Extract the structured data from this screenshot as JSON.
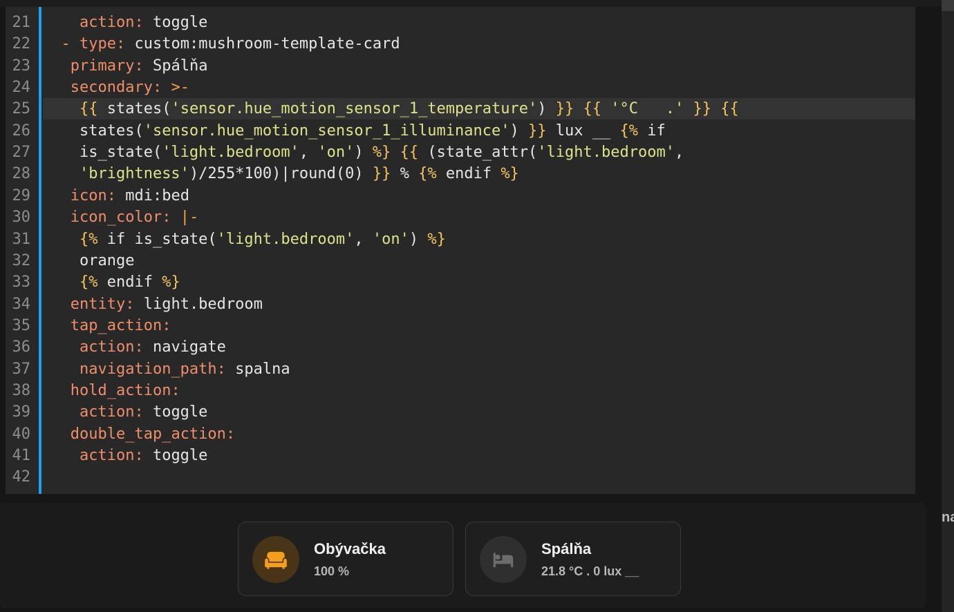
{
  "editor": {
    "lines": [
      {
        "num": "21",
        "active": false,
        "tokens": [
          {
            "t": "    ",
            "c": "plain"
          },
          {
            "t": "action:",
            "c": "key"
          },
          {
            "t": " toggle",
            "c": "plain"
          }
        ]
      },
      {
        "num": "22",
        "active": false,
        "tokens": [
          {
            "t": "  ",
            "c": "plain"
          },
          {
            "t": "-",
            "c": "dash"
          },
          {
            "t": " ",
            "c": "plain"
          },
          {
            "t": "type:",
            "c": "key"
          },
          {
            "t": " custom:mushroom-template-card",
            "c": "plain"
          }
        ]
      },
      {
        "num": "23",
        "active": false,
        "tokens": [
          {
            "t": "   ",
            "c": "plain"
          },
          {
            "t": "primary:",
            "c": "key"
          },
          {
            "t": " Spálňa",
            "c": "plain"
          }
        ]
      },
      {
        "num": "24",
        "active": false,
        "tokens": [
          {
            "t": "   ",
            "c": "plain"
          },
          {
            "t": "secondary:",
            "c": "key"
          },
          {
            "t": " >-",
            "c": "dash"
          }
        ]
      },
      {
        "num": "25",
        "active": true,
        "tokens": [
          {
            "t": "    ",
            "c": "plain"
          },
          {
            "t": "{{",
            "c": "brace"
          },
          {
            "t": " states(",
            "c": "plain"
          },
          {
            "t": "'sensor.hue_motion_sensor_1_temperature'",
            "c": "str"
          },
          {
            "t": ") ",
            "c": "plain"
          },
          {
            "t": "}}",
            "c": "brace"
          },
          {
            "t": " ",
            "c": "plain"
          },
          {
            "t": "{{",
            "c": "brace"
          },
          {
            "t": " ",
            "c": "plain"
          },
          {
            "t": "'°C   .'",
            "c": "str"
          },
          {
            "t": " ",
            "c": "plain"
          },
          {
            "t": "}}",
            "c": "brace"
          },
          {
            "t": " ",
            "c": "plain"
          },
          {
            "t": "{{",
            "c": "brace"
          }
        ]
      },
      {
        "num": "26",
        "active": false,
        "tokens": [
          {
            "t": "    states(",
            "c": "plain"
          },
          {
            "t": "'sensor.hue_motion_sensor_1_illuminance'",
            "c": "str"
          },
          {
            "t": ") ",
            "c": "plain"
          },
          {
            "t": "}}",
            "c": "brace"
          },
          {
            "t": " lux __ ",
            "c": "plain"
          },
          {
            "t": "{%",
            "c": "brace"
          },
          {
            "t": " if",
            "c": "plain"
          }
        ]
      },
      {
        "num": "27",
        "active": false,
        "tokens": [
          {
            "t": "    is_state(",
            "c": "plain"
          },
          {
            "t": "'light.bedroom'",
            "c": "str"
          },
          {
            "t": ", ",
            "c": "plain"
          },
          {
            "t": "'on'",
            "c": "str"
          },
          {
            "t": ") ",
            "c": "plain"
          },
          {
            "t": "%}",
            "c": "brace"
          },
          {
            "t": " ",
            "c": "plain"
          },
          {
            "t": "{{",
            "c": "brace"
          },
          {
            "t": " (state_attr(",
            "c": "plain"
          },
          {
            "t": "'light.bedroom'",
            "c": "str"
          },
          {
            "t": ",",
            "c": "plain"
          }
        ]
      },
      {
        "num": "28",
        "active": false,
        "tokens": [
          {
            "t": "    ",
            "c": "plain"
          },
          {
            "t": "'brightness'",
            "c": "str"
          },
          {
            "t": ")/255*100)|round(0) ",
            "c": "plain"
          },
          {
            "t": "}}",
            "c": "brace"
          },
          {
            "t": " % ",
            "c": "plain"
          },
          {
            "t": "{%",
            "c": "brace"
          },
          {
            "t": " endif ",
            "c": "plain"
          },
          {
            "t": "%}",
            "c": "brace"
          }
        ]
      },
      {
        "num": "29",
        "active": false,
        "tokens": [
          {
            "t": "   ",
            "c": "plain"
          },
          {
            "t": "icon:",
            "c": "key"
          },
          {
            "t": " mdi:bed",
            "c": "plain"
          }
        ]
      },
      {
        "num": "30",
        "active": false,
        "tokens": [
          {
            "t": "   ",
            "c": "plain"
          },
          {
            "t": "icon_color:",
            "c": "key"
          },
          {
            "t": " |-",
            "c": "dash"
          }
        ]
      },
      {
        "num": "31",
        "active": false,
        "tokens": [
          {
            "t": "    ",
            "c": "plain"
          },
          {
            "t": "{%",
            "c": "brace"
          },
          {
            "t": " if is_state(",
            "c": "plain"
          },
          {
            "t": "'light.bedroom'",
            "c": "str"
          },
          {
            "t": ", ",
            "c": "plain"
          },
          {
            "t": "'on'",
            "c": "str"
          },
          {
            "t": ") ",
            "c": "plain"
          },
          {
            "t": "%}",
            "c": "brace"
          }
        ]
      },
      {
        "num": "32",
        "active": false,
        "tokens": [
          {
            "t": "    orange",
            "c": "plain"
          }
        ]
      },
      {
        "num": "33",
        "active": false,
        "tokens": [
          {
            "t": "    ",
            "c": "plain"
          },
          {
            "t": "{%",
            "c": "brace"
          },
          {
            "t": " endif ",
            "c": "plain"
          },
          {
            "t": "%}",
            "c": "brace"
          }
        ]
      },
      {
        "num": "34",
        "active": false,
        "tokens": [
          {
            "t": "   ",
            "c": "plain"
          },
          {
            "t": "entity:",
            "c": "key"
          },
          {
            "t": " light.bedroom",
            "c": "plain"
          }
        ]
      },
      {
        "num": "35",
        "active": false,
        "tokens": [
          {
            "t": "   ",
            "c": "plain"
          },
          {
            "t": "tap_action:",
            "c": "key"
          }
        ]
      },
      {
        "num": "36",
        "active": false,
        "tokens": [
          {
            "t": "    ",
            "c": "plain"
          },
          {
            "t": "action:",
            "c": "key"
          },
          {
            "t": " navigate",
            "c": "plain"
          }
        ]
      },
      {
        "num": "37",
        "active": false,
        "tokens": [
          {
            "t": "    ",
            "c": "plain"
          },
          {
            "t": "navigation_path:",
            "c": "key"
          },
          {
            "t": " spalna",
            "c": "plain"
          }
        ]
      },
      {
        "num": "38",
        "active": false,
        "tokens": [
          {
            "t": "   ",
            "c": "plain"
          },
          {
            "t": "hold_action:",
            "c": "key"
          }
        ]
      },
      {
        "num": "39",
        "active": false,
        "tokens": [
          {
            "t": "    ",
            "c": "plain"
          },
          {
            "t": "action:",
            "c": "key"
          },
          {
            "t": " toggle",
            "c": "plain"
          }
        ]
      },
      {
        "num": "40",
        "active": false,
        "tokens": [
          {
            "t": "   ",
            "c": "plain"
          },
          {
            "t": "double_tap_action:",
            "c": "key"
          }
        ]
      },
      {
        "num": "41",
        "active": false,
        "tokens": [
          {
            "t": "    ",
            "c": "plain"
          },
          {
            "t": "action:",
            "c": "key"
          },
          {
            "t": " toggle",
            "c": "plain"
          }
        ]
      },
      {
        "num": "42",
        "active": false,
        "tokens": []
      }
    ]
  },
  "preview": {
    "cards": [
      {
        "title": "Obývačka",
        "subtitle": "100 %",
        "icon": "sofa-icon",
        "icon_color": "#f59e1b",
        "icon_bg": "#4a3418"
      },
      {
        "title": "Spálňa",
        "subtitle": "21.8 °C . 0 lux __",
        "icon": "bed-icon",
        "icon_color": "#6c6c6c",
        "icon_bg": "#2f2f2f"
      }
    ]
  },
  "side_panel": {
    "fragment": "na"
  },
  "colors": {
    "key": "#f08d6a",
    "string": "#dfe28a",
    "brace": "#f4c45a",
    "accent": "#1ea0f0"
  }
}
